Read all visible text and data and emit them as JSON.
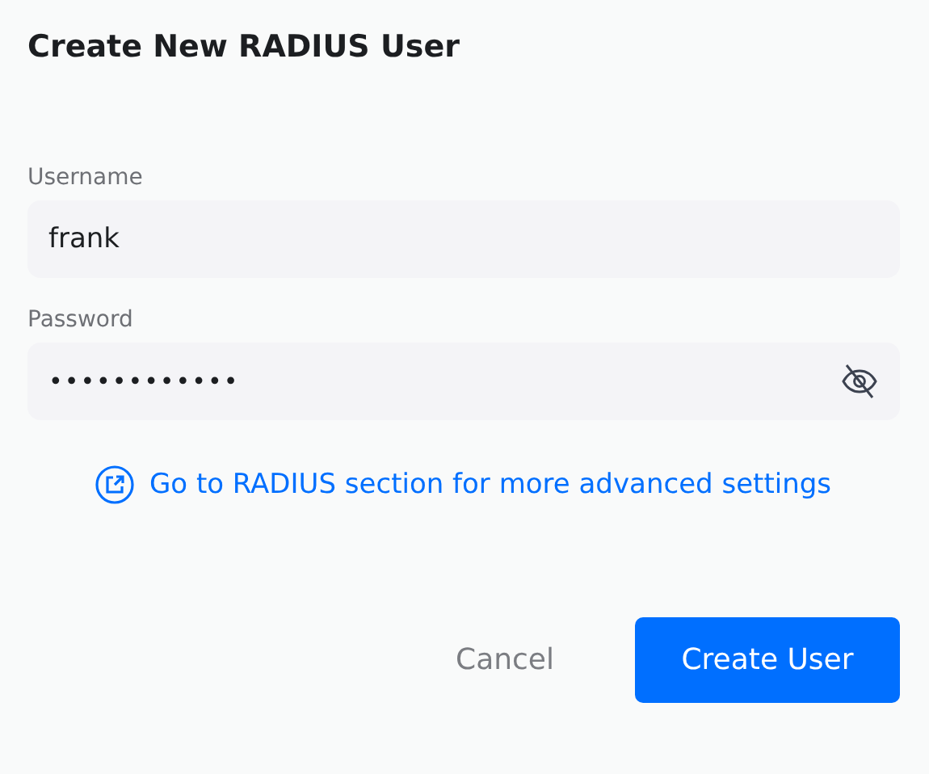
{
  "dialog": {
    "title": "Create New RADIUS User"
  },
  "fields": [
    {
      "label": "Username",
      "value": "frank",
      "kind": "text"
    },
    {
      "label": "Password",
      "value": "••••••••••••",
      "kind": "password"
    }
  ],
  "link": {
    "text": "Go to RADIUS section for more advanced settings"
  },
  "buttons": [
    {
      "label": "Cancel",
      "kind": "secondary"
    },
    {
      "label": "Create User",
      "kind": "primary"
    }
  ]
}
